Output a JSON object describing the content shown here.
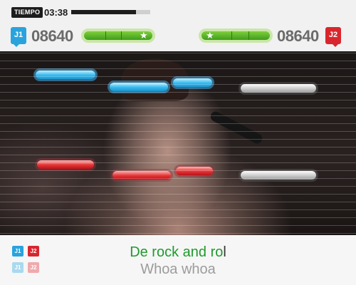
{
  "hud": {
    "timer_label": "TIEMPO",
    "timer_value": "03:38",
    "timer_progress": 0.82
  },
  "players": [
    {
      "tag": "J1",
      "score": "08640",
      "color": "#2aa3dd",
      "meter_level": 1.0
    },
    {
      "tag": "J2",
      "score": "08640",
      "color": "#d9262e",
      "meter_level": 1.0
    }
  ],
  "note_colors": {
    "player1": "#36b9ef",
    "player2": "#e43333",
    "upcoming": "#c9c9c9"
  },
  "lyrics": {
    "current_sung": "De rock and ro",
    "current_cursor": "l",
    "current_rest": "l",
    "next_line": "Whoa whoa"
  },
  "lyric_tags": [
    {
      "tag": "J1",
      "color": "#2aa3dd"
    },
    {
      "tag": "J2",
      "color": "#d9262e"
    },
    {
      "tag": "J1",
      "color": "#a9d9ef"
    },
    {
      "tag": "J2",
      "color": "#f0a9ad"
    }
  ]
}
